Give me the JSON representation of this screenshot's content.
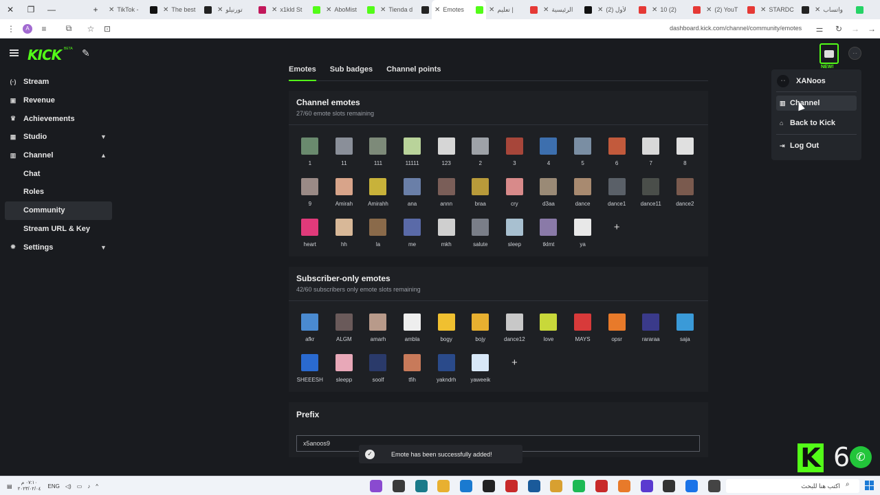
{
  "browser": {
    "tabs": [
      {
        "title": "TikTok -",
        "fav": "tiktok-icon",
        "color": "#111111"
      },
      {
        "title": "The best",
        "fav": "github-icon",
        "color": "#222222"
      },
      {
        "title": "تورنيلو",
        "fav": "app-icon",
        "color": "#c2185b"
      },
      {
        "title": "x1kld St",
        "fav": "kick-icon",
        "color": "#53fc18"
      },
      {
        "title": "AboMist",
        "fav": "kick-icon",
        "color": "#53fc18"
      },
      {
        "title": "Tienda d",
        "fav": "github-icon",
        "color": "#222222"
      },
      {
        "title": "Emotes",
        "fav": "kick-icon",
        "color": "#53fc18",
        "active": true
      },
      {
        "title": "تعليم |",
        "fav": "youtube-icon",
        "color": "#e53935"
      },
      {
        "title": "الرئيسية",
        "fav": "x-icon",
        "color": "#111111"
      },
      {
        "title": "(2) لأول",
        "fav": "youtube-icon",
        "color": "#e53935"
      },
      {
        "title": "10 (2)",
        "fav": "youtube-icon",
        "color": "#e53935"
      },
      {
        "title": "(2) YouT",
        "fav": "youtube-icon",
        "color": "#e53935"
      },
      {
        "title": "STARDC",
        "fav": "app-icon",
        "color": "#222222"
      },
      {
        "title": "واتساب",
        "fav": "whatsapp-icon",
        "color": "#25d366"
      }
    ],
    "url": "dashboard.kick.com/channel/community/emotes",
    "profile_initial": "A"
  },
  "header": {
    "logo": "KICK",
    "logo_beta": "BETA",
    "new_label": "NEW!",
    "avatar_text": "- -"
  },
  "sidebar": {
    "items": [
      {
        "label": "Stream",
        "icon": "stream-icon",
        "glyph": "(·)"
      },
      {
        "label": "Revenue",
        "icon": "revenue-icon",
        "glyph": "▣"
      },
      {
        "label": "Achievements",
        "icon": "trophy-icon",
        "glyph": "♛"
      },
      {
        "label": "Studio",
        "icon": "studio-icon",
        "glyph": "▦",
        "chevron": "down"
      },
      {
        "label": "Channel",
        "icon": "channel-icon",
        "glyph": "▥",
        "chevron": "up"
      }
    ],
    "sub_items": [
      "Chat",
      "Roles",
      "Community",
      "Stream URL & Key"
    ],
    "active_sub": "Community",
    "settings": {
      "label": "Settings",
      "icon": "gear-icon",
      "glyph": "✹",
      "chevron": "down"
    }
  },
  "page_tabs": [
    "Emotes",
    "Sub badges",
    "Channel points"
  ],
  "channel_emotes": {
    "title": "Channel emotes",
    "subtitle": "27/60 emote slots remaining",
    "items": [
      {
        "name": "1",
        "color": "#6a8a6e"
      },
      {
        "name": "11",
        "color": "#8a8f99"
      },
      {
        "name": "111",
        "color": "#7d8a79"
      },
      {
        "name": "11111",
        "color": "#b9d39a"
      },
      {
        "name": "123",
        "color": "#d6d6d6"
      },
      {
        "name": "2",
        "color": "#9ea2a8"
      },
      {
        "name": "3",
        "color": "#a7463a"
      },
      {
        "name": "4",
        "color": "#3d6fae"
      },
      {
        "name": "5",
        "color": "#7a8ea3"
      },
      {
        "name": "6",
        "color": "#c25a3c"
      },
      {
        "name": "7",
        "color": "#d8d8d8"
      },
      {
        "name": "8",
        "color": "#e0e0e0"
      },
      {
        "name": "9",
        "color": "#9a8a86"
      },
      {
        "name": "Amirah",
        "color": "#d8a48a"
      },
      {
        "name": "Amirahh",
        "color": "#c8b23a"
      },
      {
        "name": "ana",
        "color": "#6a7fa8"
      },
      {
        "name": "annn",
        "color": "#7a5e58"
      },
      {
        "name": "braa",
        "color": "#b89a3a"
      },
      {
        "name": "cry",
        "color": "#d88a8a"
      },
      {
        "name": "d3aa",
        "color": "#9a8a76"
      },
      {
        "name": "dance",
        "color": "#a88a70"
      },
      {
        "name": "dance1",
        "color": "#5a6068"
      },
      {
        "name": "dance11",
        "color": "#4a4e4a"
      },
      {
        "name": "dance2",
        "color": "#7a5a4e"
      },
      {
        "name": "heart",
        "color": "#e03a7a"
      },
      {
        "name": "hh",
        "color": "#d8b898"
      },
      {
        "name": "la",
        "color": "#8a6a4a"
      },
      {
        "name": "me",
        "color": "#5a6aa8"
      },
      {
        "name": "mkh",
        "color": "#cfcfcf"
      },
      {
        "name": "salute",
        "color": "#7a7e88"
      },
      {
        "name": "sleep",
        "color": "#a8c0d0"
      },
      {
        "name": "tklmt",
        "color": "#8a7aa8"
      },
      {
        "name": "ya",
        "color": "#e8e8e8"
      }
    ]
  },
  "subscriber_emotes": {
    "title": "Subscriber-only emotes",
    "subtitle": "42/60 subscribers only emote slots remaining",
    "items": [
      {
        "name": "afkr",
        "color": "#4a8ad0"
      },
      {
        "name": "ALGM",
        "color": "#6a5a5a"
      },
      {
        "name": "amarh",
        "color": "#b89a8a"
      },
      {
        "name": "ambla",
        "color": "#eeeeee"
      },
      {
        "name": "bogy",
        "color": "#f0c030"
      },
      {
        "name": "bojy",
        "color": "#e8b030"
      },
      {
        "name": "dance12",
        "color": "#c8c8c8"
      },
      {
        "name": "love",
        "color": "#c8d83a"
      },
      {
        "name": "MAYS",
        "color": "#d83a3a"
      },
      {
        "name": "opsr",
        "color": "#e87a2a"
      },
      {
        "name": "rararaa",
        "color": "#3a3a8a"
      },
      {
        "name": "saja",
        "color": "#3a9ad8"
      },
      {
        "name": "SHEEESH",
        "color": "#2a6ad0"
      },
      {
        "name": "sleepp",
        "color": "#e8a8b8"
      },
      {
        "name": "soolf",
        "color": "#2a3a6a"
      },
      {
        "name": "tfih",
        "color": "#c87a5a"
      },
      {
        "name": "yakndrh",
        "color": "#2a4a8a"
      },
      {
        "name": "yaweeik",
        "color": "#d8e8f8"
      }
    ]
  },
  "add_symbol": "+",
  "prefix": {
    "title": "Prefix",
    "value": "x5anoos9"
  },
  "toast": {
    "message": "Emote has been successfully added!",
    "check": "✓"
  },
  "dropdown": {
    "username": "XANoos",
    "avatar_text": "- -",
    "items": [
      {
        "label": "Channel",
        "icon": "channel-icon",
        "glyph": "▥",
        "hover": true
      },
      {
        "label": "Back to Kick",
        "icon": "home-icon",
        "glyph": "⌂"
      },
      {
        "label": "Log Out",
        "icon": "logout-icon",
        "glyph": "⇥"
      }
    ]
  },
  "overlay": {
    "letter": "K",
    "number": "6"
  },
  "taskbar": {
    "lang": "ENG",
    "time_line1": "٠٧:١٠ م",
    "time_line2": "٢٠٢٣/٠٢/٠٤",
    "search_placeholder": "اكتب هنا للبحث",
    "apps": [
      "#8a4ad0",
      "#3a3a3a",
      "#1a7a8a",
      "#e8b030",
      "#1a7ad0",
      "#222222",
      "#c82a2a",
      "#1a5a9a",
      "#d8a030",
      "#1db954",
      "#c82a2a",
      "#e87a2a",
      "#5a3ad0",
      "#333333",
      "#1a73e8",
      "#444444"
    ]
  }
}
